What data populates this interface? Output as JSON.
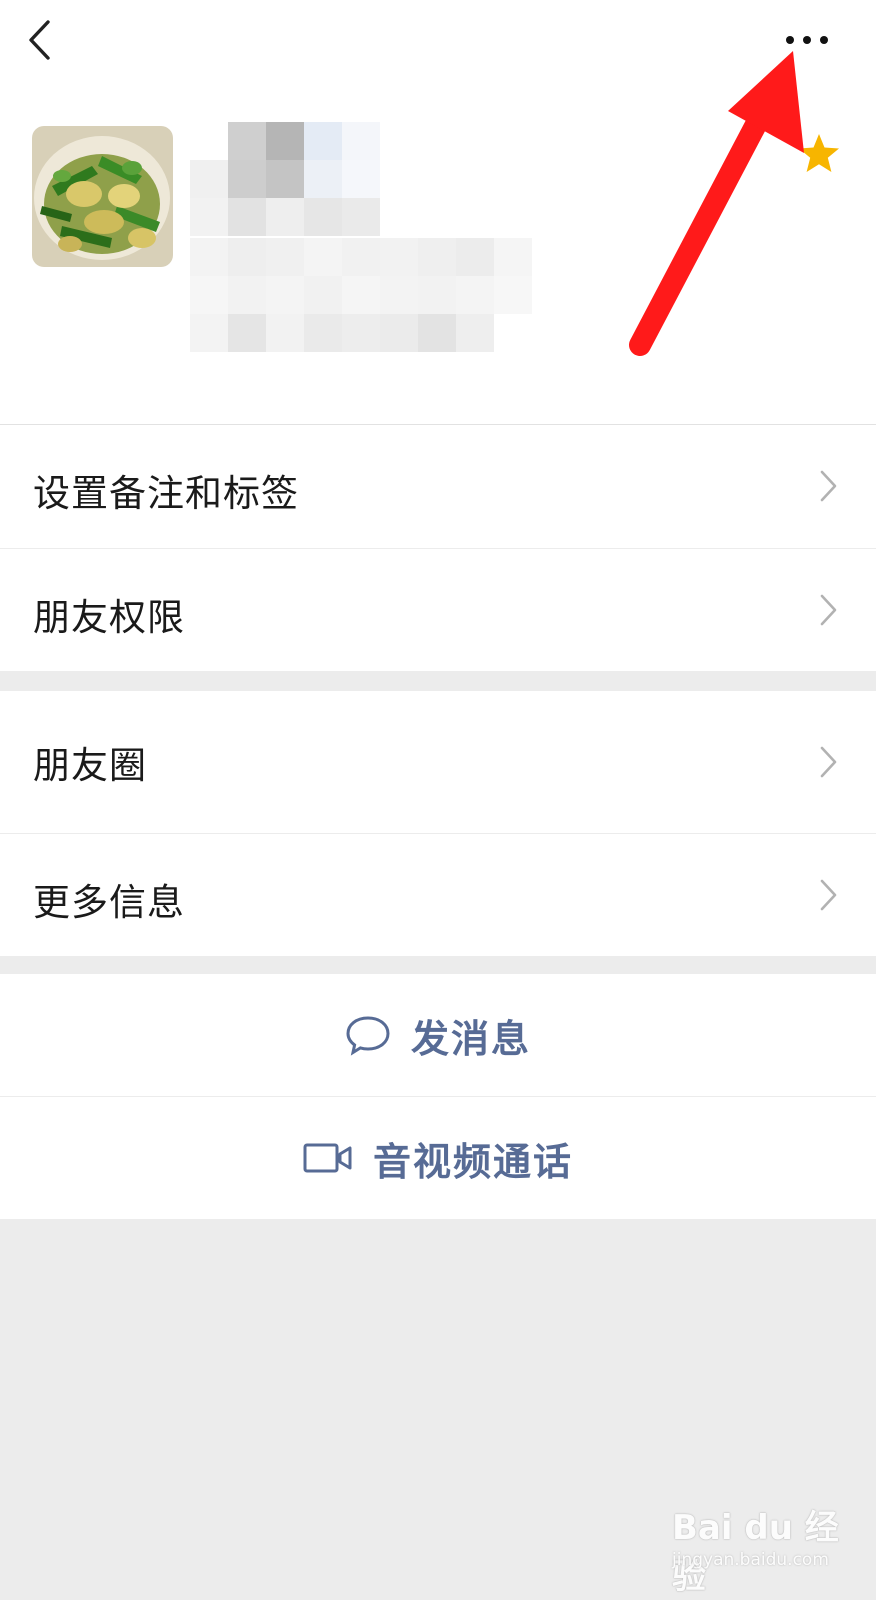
{
  "menu": {
    "items": [
      {
        "label": "设置备注和标签"
      },
      {
        "label": "朋友权限"
      },
      {
        "label": "朋友圈"
      },
      {
        "label": "更多信息"
      }
    ]
  },
  "actions": {
    "message_label": "发消息",
    "call_label": "音视频通话"
  },
  "watermark": {
    "main": "Bai du 经验",
    "sub": "jingyan.baidu.com"
  },
  "icons": {
    "back": "chevron-left-icon",
    "more": "more-dots-icon",
    "star": "star-icon",
    "chevron": "chevron-right-icon",
    "message": "chat-bubble-icon",
    "call": "video-camera-icon"
  },
  "colors": {
    "accent_text": "#576b95",
    "star": "#f7b500",
    "arrow": "#ff1a1a",
    "page_bg": "#ececec"
  }
}
